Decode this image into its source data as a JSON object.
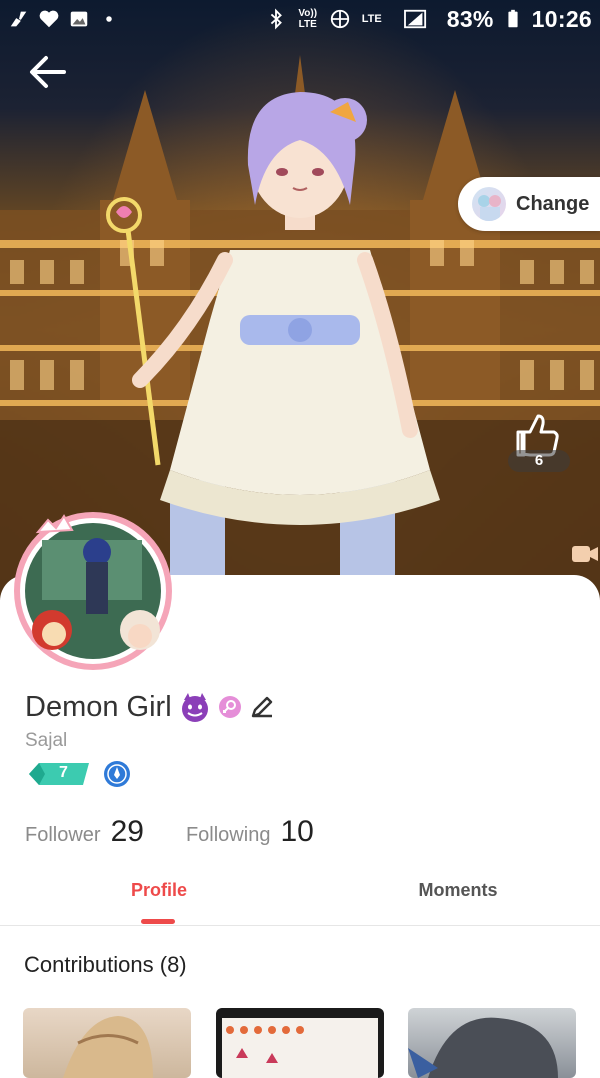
{
  "status_bar": {
    "battery": "83%",
    "time": "10:26",
    "left_icons": [
      "cleaner-icon",
      "heart-icon",
      "image-icon",
      "dot-icon"
    ],
    "right_icons": [
      "bluetooth-icon",
      "volte-icon",
      "hotspot-icon",
      "lte-icon",
      "signal-icon",
      "battery-icon"
    ],
    "volte_label": "Vo)) LTE",
    "lte_label": "LTE"
  },
  "header": {
    "change_label": "Change",
    "like_count": "6"
  },
  "profile": {
    "name": "Demon Girl",
    "username": "Sajal",
    "level": "7"
  },
  "stats": {
    "follower_label": "Follower",
    "follower_count": "29",
    "following_label": "Following",
    "following_count": "10"
  },
  "tabs": {
    "profile_label": "Profile",
    "moments_label": "Moments",
    "active": "Profile"
  },
  "contributions": {
    "title": "Contributions (8)"
  },
  "colors": {
    "accent": "#ee4a4a",
    "level_badge": "#3ccbb0",
    "blue_badge": "#2f7ad8",
    "gender_badge": "#e58ed8"
  }
}
